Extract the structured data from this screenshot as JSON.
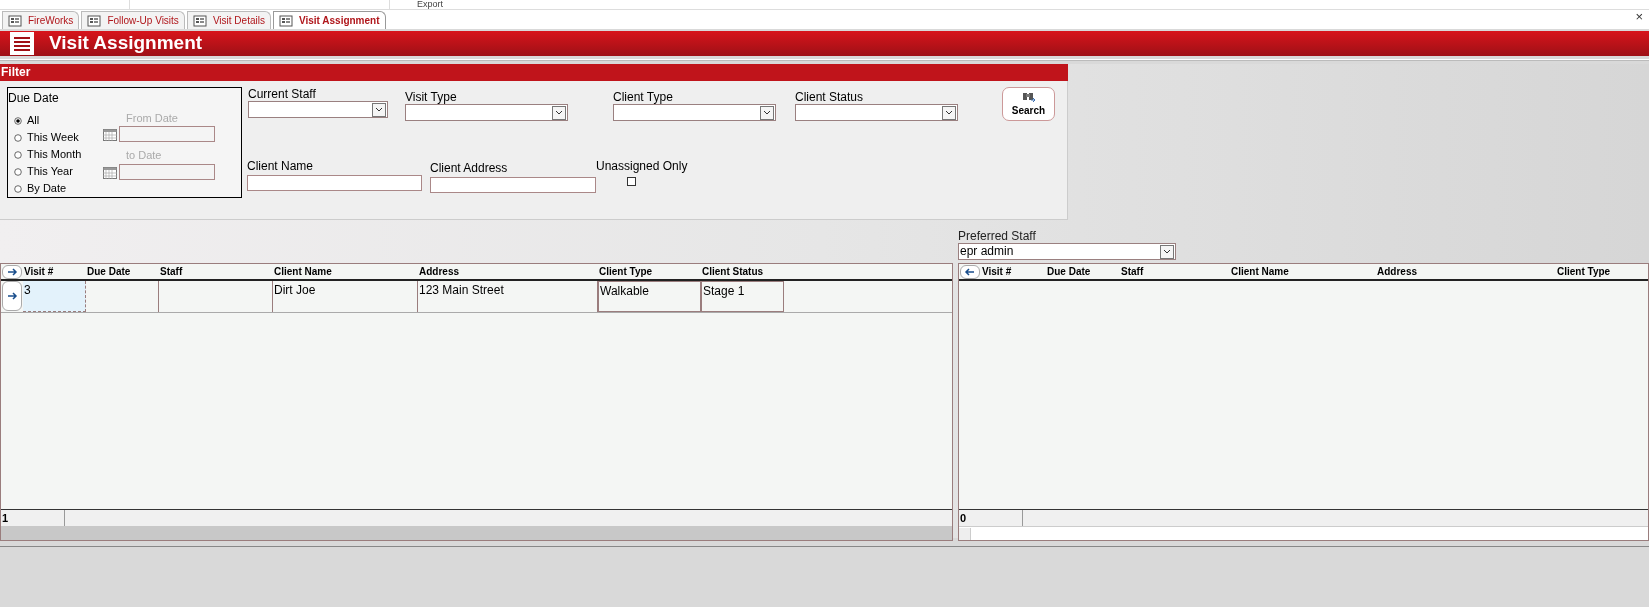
{
  "ribbon": {
    "group_label": "Export"
  },
  "tabs": [
    {
      "label": "FireWorks",
      "selected": false
    },
    {
      "label": "Follow-Up Visits",
      "selected": false
    },
    {
      "label": "Visit Details",
      "selected": false
    },
    {
      "label": "Visit Assignment",
      "selected": true
    }
  ],
  "close_glyph": "×",
  "header": {
    "title": "Visit Assignment"
  },
  "filter": {
    "title": "Filter",
    "due_date": {
      "label": "Due Date",
      "options": [
        {
          "label": "All",
          "selected": true
        },
        {
          "label": "This Week",
          "selected": false
        },
        {
          "label": "This Month",
          "selected": false
        },
        {
          "label": "This Year",
          "selected": false
        },
        {
          "label": "By Date",
          "selected": false
        }
      ],
      "from_label": "From Date",
      "to_label": "to Date",
      "dates_disabled": true
    },
    "dropdowns": [
      {
        "label": "Current Staff"
      },
      {
        "label": "Visit Type"
      },
      {
        "label": "Client  Type"
      },
      {
        "label": "Client Status"
      }
    ],
    "search_button": "Search",
    "client_name": {
      "label": "Client Name"
    },
    "client_address": {
      "label": "Client Address"
    },
    "unassigned_only": {
      "label": "Unassigned Only",
      "checked": false
    }
  },
  "preferred_staff": {
    "label": "Preferred Staff",
    "value": "epr admin"
  },
  "left_grid": {
    "columns": [
      "Visit #",
      "Due Date",
      "Staff",
      "Client Name",
      "Address",
      "Client  Type",
      "Client  Status"
    ],
    "rows": [
      {
        "cells": [
          "3",
          "",
          "",
          "Dirt Joe",
          "123 Main Street",
          "Walkable",
          "Stage 1"
        ],
        "selected": true
      }
    ],
    "record_count": "1"
  },
  "right_grid": {
    "columns": [
      "Visit #",
      "Due Date",
      "Staff",
      "Client Name",
      "Address",
      "Client  Type"
    ],
    "record_count": "0"
  }
}
